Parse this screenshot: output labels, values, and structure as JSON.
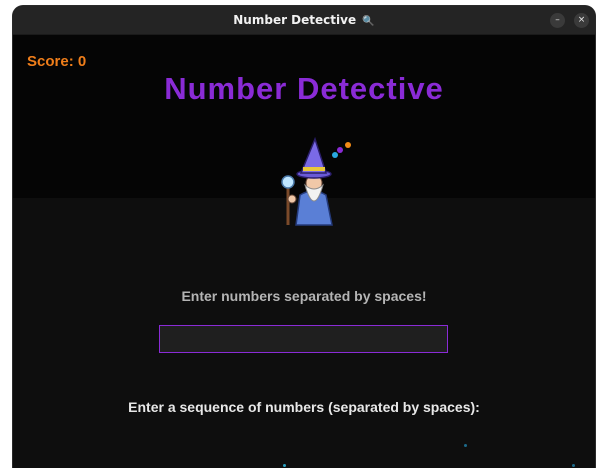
{
  "window": {
    "title": "Number Detective",
    "title_icon": "magnifier-icon",
    "controls": {
      "minimize": "–",
      "close": "×"
    }
  },
  "app": {
    "score_label": "Score: 0",
    "title": "Number Detective",
    "mascot_icon": "wizard-icon",
    "instruction": "Enter numbers separated by spaces!",
    "input": {
      "value": "",
      "placeholder": ""
    },
    "prompt": "Enter a sequence of numbers (separated by spaces):"
  },
  "colors": {
    "accent": "#8a2bd6",
    "score": "#f07e1a",
    "background": "#0c0c0c",
    "titlebar": "#242424"
  }
}
